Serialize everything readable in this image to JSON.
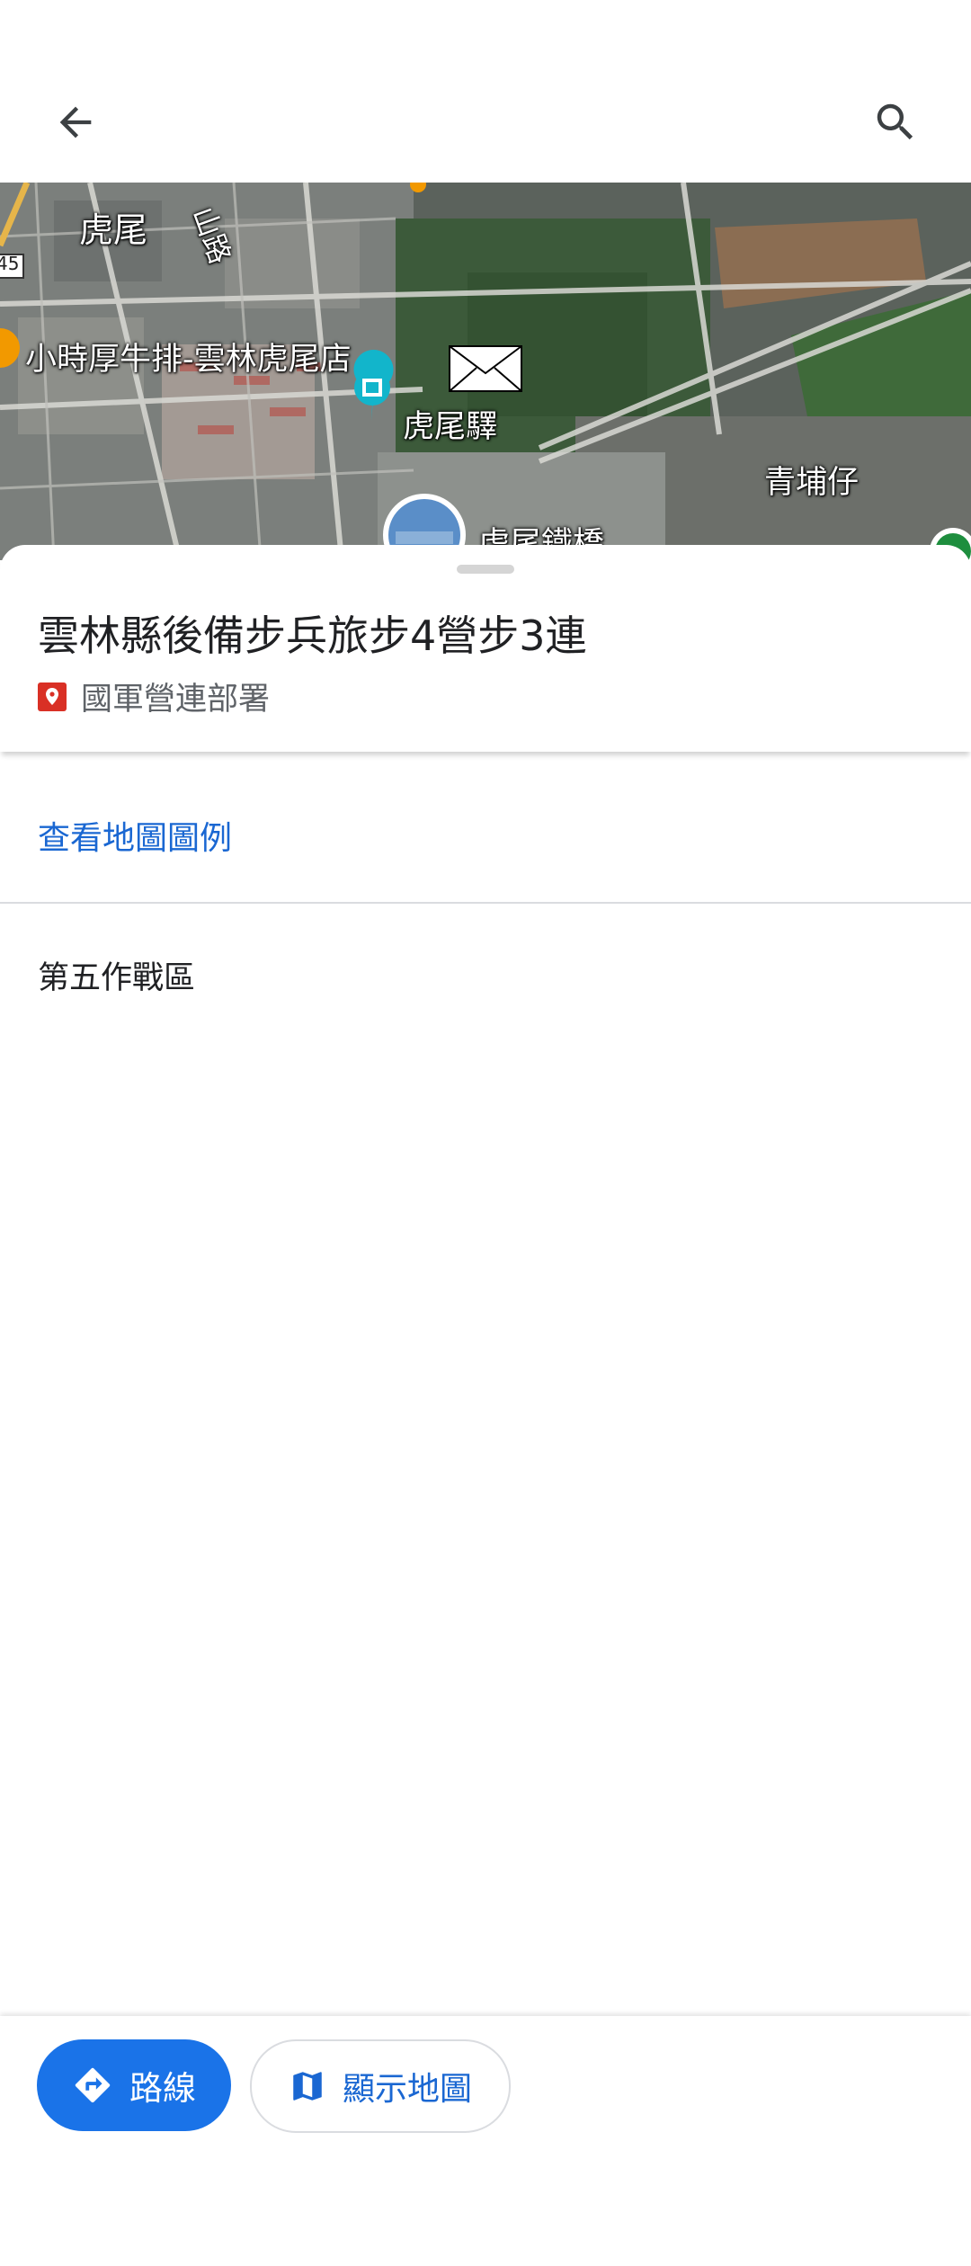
{
  "topbar": {
    "back_icon": "arrow-back-icon",
    "search_icon": "search-icon"
  },
  "map": {
    "labels": {
      "huwei": "虎尾",
      "road": "山路",
      "route_number": "45",
      "steak": "小時厚牛排-雲林虎尾店",
      "station": "虎尾驛",
      "qingpuzi": "青埔仔",
      "bridge": "虎尾鐵橋"
    }
  },
  "place": {
    "title": "雲林縣後備步兵旅步4營步3連",
    "category": "國軍營連部署",
    "category_color": "#d93025"
  },
  "legend_link": "查看地圖圖例",
  "zone": "第五作戰區",
  "actions": {
    "route_label": "路線",
    "show_map_label": "顯示地圖",
    "primary_color": "#1a73e8"
  }
}
